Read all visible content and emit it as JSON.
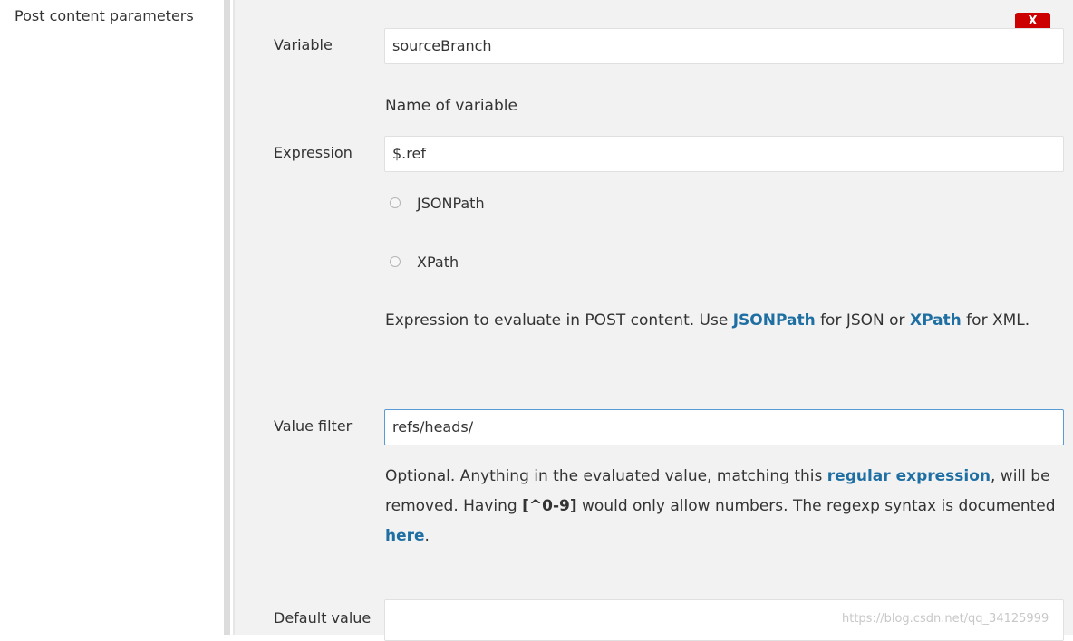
{
  "section": {
    "label": "Post content parameters"
  },
  "delete_button": {
    "label": "X"
  },
  "variable": {
    "label": "Variable",
    "value": "sourceBranch",
    "help": "Name of variable"
  },
  "expression": {
    "label": "Expression",
    "value": "$.ref",
    "options": [
      "JSONPath",
      "XPath"
    ],
    "help": {
      "part1": "Expression to evaluate in POST content. Use ",
      "link1": "JSONPath",
      "part2": " for JSON or ",
      "link2": "XPath",
      "part3": " for XML."
    }
  },
  "value_filter": {
    "label": "Value filter",
    "value": "refs/heads/",
    "help": {
      "part1": "Optional. Anything in the evaluated value, matching this ",
      "link1": "regular expression",
      "part2": ", will be removed. Having ",
      "code": "[^0-9]",
      "part3": " would only allow numbers. The regexp syntax is documented ",
      "link2": "here",
      "part4": "."
    }
  },
  "default_value": {
    "label": "Default value",
    "value": ""
  },
  "watermark": "https://blog.csdn.net/qq_34125999",
  "colors": {
    "panel_bg": "#f2f2f2",
    "link": "#1f6fa3",
    "delete": "#cc0000",
    "focus_border": "#5b9bd5"
  }
}
